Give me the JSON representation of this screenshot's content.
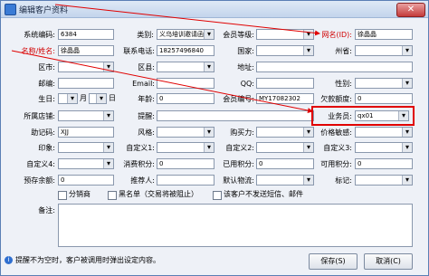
{
  "window": {
    "title": "编辑客户资料",
    "close_label": "✕"
  },
  "fields": {
    "sys_code": {
      "label": "系统编码:",
      "value": "6384"
    },
    "category": {
      "label": "类别:",
      "value": "义乌培训邀请函"
    },
    "member_level": {
      "label": "会员等级:",
      "value": ""
    },
    "wangwang": {
      "label": "网名(ID):",
      "value": "徐晶晶"
    },
    "name": {
      "label": "名称/姓名:",
      "value": "徐晶晶"
    },
    "phone": {
      "label": "联系电话:",
      "value": "18257496840"
    },
    "country": {
      "label": "国家:",
      "value": ""
    },
    "province": {
      "label": "州省:",
      "value": ""
    },
    "city": {
      "label": "区市:",
      "value": ""
    },
    "county": {
      "label": "区县:",
      "value": ""
    },
    "address": {
      "label": "地址:",
      "value": ""
    },
    "postcode": {
      "label": "邮编:",
      "value": ""
    },
    "email": {
      "label": "Email:",
      "value": ""
    },
    "qq": {
      "label": "QQ:",
      "value": ""
    },
    "gender": {
      "label": "性别:",
      "value": ""
    },
    "birthday": {
      "label": "生日:",
      "month_label": "月",
      "day_label": "日"
    },
    "age": {
      "label": "年龄:",
      "value": "0"
    },
    "member_no": {
      "label": "会员编号:",
      "value": "MY17082302"
    },
    "owed": {
      "label": "欠款额度:",
      "value": "0"
    },
    "store": {
      "label": "所属店铺:",
      "value": ""
    },
    "reminder": {
      "label": "提醒:",
      "value": ""
    },
    "salesman": {
      "label": "业务员:",
      "value": "qx01"
    },
    "mnemonic": {
      "label": "助记码:",
      "value": "XJJ"
    },
    "style": {
      "label": "风格:",
      "value": ""
    },
    "purchase_power": {
      "label": "购买力:",
      "value": ""
    },
    "price_sensitivity": {
      "label": "价格敏感:",
      "value": ""
    },
    "impression": {
      "label": "印象:",
      "value": ""
    },
    "custom1": {
      "label": "自定义1:",
      "value": ""
    },
    "custom2": {
      "label": "自定义2:",
      "value": ""
    },
    "custom3": {
      "label": "自定义3:",
      "value": ""
    },
    "custom4": {
      "label": "自定义4:",
      "value": ""
    },
    "consumption": {
      "label": "消费积分:",
      "value": "0"
    },
    "used_points": {
      "label": "已用积分:",
      "value": "0"
    },
    "available_points": {
      "label": "可用积分:",
      "value": "0"
    },
    "deposit": {
      "label": "预存余额:",
      "value": "0"
    },
    "referrer": {
      "label": "推荐人:",
      "value": ""
    },
    "logistics": {
      "label": "默认物流:",
      "value": ""
    },
    "tag": {
      "label": "标记:",
      "value": ""
    }
  },
  "checkboxes": [
    {
      "label": "分销商"
    },
    {
      "label": "黑名单（交易将被阻止）"
    },
    {
      "label": "该客户不发送短信、邮件"
    }
  ],
  "remark": {
    "label": "备注:",
    "value": ""
  },
  "footer": {
    "note": "提醒不为空时，客户被调用时弹出设定内容。",
    "save_label": "保存(S)",
    "cancel_label": "取消(C)"
  },
  "colors": {
    "highlight": "#e00000",
    "title_bg": "#c3d4ec"
  }
}
